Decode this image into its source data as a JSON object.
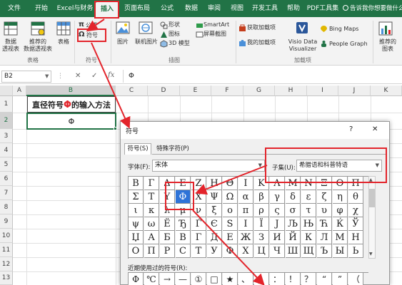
{
  "ribbon_tabs": [
    {
      "label": "文件"
    },
    {
      "label": "开始"
    },
    {
      "label": "Excel与财务"
    },
    {
      "label": "插入",
      "active": true
    },
    {
      "label": "页面布局"
    },
    {
      "label": "公式"
    },
    {
      "label": "数据"
    },
    {
      "label": "审阅"
    },
    {
      "label": "视图"
    },
    {
      "label": "开发工具"
    },
    {
      "label": "帮助"
    },
    {
      "label": "PDF工具集"
    }
  ],
  "tell_me": "告诉我你想要做什么",
  "ribbon": {
    "pivot_table": [
      "数据",
      "透视表"
    ],
    "recommended_pivot": [
      "推荐的",
      "数据透视表"
    ],
    "table": "表格",
    "formula": "公式",
    "symbol": "符号",
    "picture": "图片",
    "online_picture": "联机图片",
    "shapes": "形状",
    "icons": "图标",
    "model3d": "3D 模型",
    "smartart": "SmartArt",
    "screenshot": "屏幕截图",
    "get_addins": "获取加载项",
    "my_addins": "我的加载项",
    "visio": [
      "Visio Data",
      "Visualizer"
    ],
    "bing_maps": "Bing Maps",
    "people_graph": "People Graph",
    "recommended_charts": [
      "推荐的",
      "图表"
    ],
    "groups": {
      "tables": "表格",
      "symbols": "符号",
      "illustrations": "插图",
      "addins": "加载项"
    }
  },
  "formula_bar": {
    "name_box": "B2",
    "cancel": "✕",
    "enter": "✓",
    "fx": "fx",
    "content": "Φ"
  },
  "sheet": {
    "columns": [
      "A",
      "B",
      "C",
      "D",
      "E",
      "F",
      "G",
      "H",
      "I",
      "J",
      "K"
    ],
    "rows": [
      "1",
      "2",
      "3",
      "4",
      "5",
      "6",
      "7",
      "8",
      "9",
      "10",
      "11",
      "12",
      "13"
    ],
    "b1_before": "直径符号",
    "b1_symbol": "Φ",
    "b1_after": "的输入方法",
    "b2": "Φ"
  },
  "dialog": {
    "title": "符号",
    "help": "?",
    "close": "✕",
    "tabs": [
      "符号(S)",
      "特殊字符(P)"
    ],
    "font_label": "字体(F):",
    "font_value": "宋体",
    "subset_label": "子集(U):",
    "subset_value": "希腊语和科普特语",
    "symbols": [
      [
        "Β",
        "Γ",
        "Δ",
        "Ε",
        "Ζ",
        "Η",
        "Θ",
        "Ι",
        "Κ",
        "Λ",
        "Μ",
        "Ν",
        "Ξ",
        "Ο",
        "Π"
      ],
      [
        "Σ",
        "Τ",
        "Υ",
        "Φ",
        "Χ",
        "Ψ",
        "Ω",
        "α",
        "β",
        "γ",
        "δ",
        "ε",
        "ζ",
        "η",
        "θ"
      ],
      [
        "ι",
        "κ",
        "λ",
        "μ",
        "ν",
        "ξ",
        "ο",
        "π",
        "ρ",
        "ς",
        "σ",
        "τ",
        "υ",
        "φ",
        "χ"
      ],
      [
        "ψ",
        "ω",
        "Ё",
        "Ђ",
        "Ѓ",
        "Є",
        "Ѕ",
        "І",
        "Ї",
        "Ј",
        "Љ",
        "Њ",
        "Ћ",
        "Ќ",
        "Ў"
      ],
      [
        "Џ",
        "А",
        "Б",
        "В",
        "Г",
        "Д",
        "Е",
        "Ж",
        "З",
        "И",
        "Й",
        "К",
        "Л",
        "М",
        "Н"
      ],
      [
        "О",
        "П",
        "Р",
        "С",
        "Т",
        "У",
        "Ф",
        "Х",
        "Ц",
        "Ч",
        "Ш",
        "Щ",
        "Ъ",
        "Ы",
        "Ь"
      ]
    ],
    "selected_symbol": "Φ",
    "recent_label": "近期使用过的符号(R):",
    "recent_symbols": [
      "Φ",
      "℃",
      "→",
      "—",
      "①",
      "□",
      "★",
      "、",
      "；",
      "：",
      "！",
      "？",
      "“",
      "”",
      "（"
    ]
  },
  "colors": {
    "excel_green": "#217346",
    "annotation_red": "#e3242b"
  }
}
